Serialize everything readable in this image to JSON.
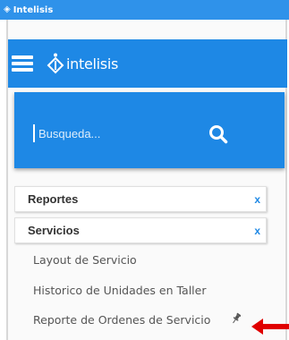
{
  "window": {
    "title": "Intelisis"
  },
  "header": {
    "brand": "intelisis"
  },
  "search": {
    "placeholder": "Busqueda..."
  },
  "sections": [
    {
      "label": "Reportes",
      "close": "x"
    },
    {
      "label": "Servicios",
      "close": "x"
    }
  ],
  "servicios_items": [
    {
      "label": "Layout de Servicio"
    },
    {
      "label": "Historico de Unidades en Taller"
    },
    {
      "label": "Reporte de Ordenes de Servicio",
      "pinned": true
    }
  ],
  "colors": {
    "primary": "#1e88e5",
    "titlebar": "#2f92ea",
    "annotation_arrow": "#e00000"
  },
  "icons": [
    "app-icon",
    "hamburger-icon",
    "intelisis-logo-icon",
    "search-icon",
    "pin-icon"
  ]
}
